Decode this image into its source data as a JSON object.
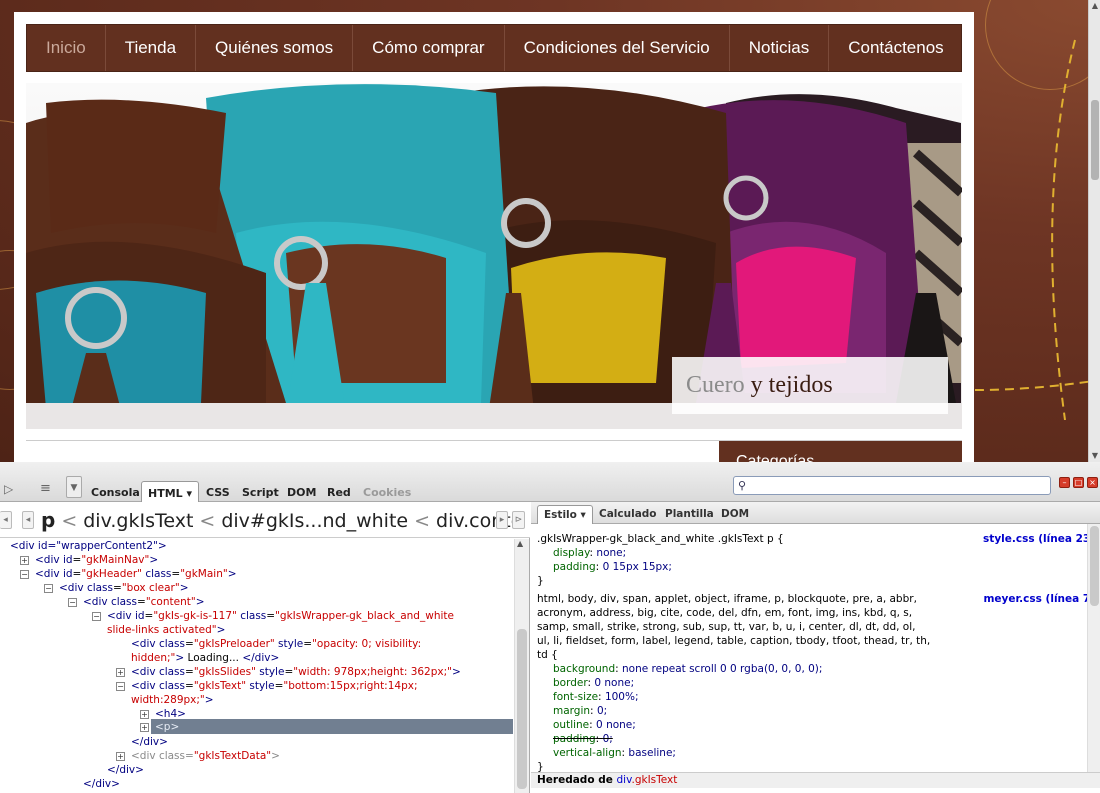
{
  "site": {
    "nav": [
      "Inicio",
      "Tienda",
      "Quiénes somos",
      "Cómo comprar",
      "Condiciones del Servicio",
      "Noticias",
      "Contáctenos"
    ],
    "caption_part1": "Cuero",
    "caption_part2": " y tejidos",
    "sidebar_heading": "Categorías"
  },
  "firebug": {
    "tabs": {
      "console": "Consola",
      "html": "HTML ▾",
      "css": "CSS",
      "script": "Script",
      "dom": "DOM",
      "net": "Red",
      "cookies": "Cookies"
    },
    "search_placeholder": "",
    "breadcrumb": {
      "first": "p",
      "items": [
        "div.gkIsText",
        "div#gkIs...nd_white",
        "div.conte"
      ]
    },
    "tree": [
      {
        "id": "r0",
        "text_tag": "<div id=\"wrapperContent2\">"
      },
      {
        "id": "r1",
        "tag": "<div ",
        "an": "id",
        "av": "\"gkMainNav\"",
        "end": ">"
      },
      {
        "id": "r2",
        "tag": "<div ",
        "an": "id",
        "av": "\"gkHeader\"",
        "an2": " class",
        "av2": "\"gkMain\"",
        "end": ">"
      },
      {
        "id": "r3",
        "tag": "<div ",
        "an": "class",
        "av": "\"box clear\"",
        "end": ">"
      },
      {
        "id": "r4",
        "tag": "<div ",
        "an": "class",
        "av": "\"content\"",
        "end": ">"
      },
      {
        "id": "r5",
        "tag": "<div ",
        "an": "id",
        "av": "\"gkIs-gk-is-117\"",
        "an2": " class",
        "av2": "\"gkIsWrapper-gk_black_and_white"
      },
      {
        "id": "r5b",
        "av": "slide-links activated\"",
        "end": ">"
      },
      {
        "id": "r6",
        "tag": "<div ",
        "an": "class",
        "av": "\"gkIsPreloader\"",
        "an2": " style",
        "av2": "\"opacity: 0; visibility:"
      },
      {
        "id": "r6b",
        "av": "hidden;\"",
        "end": ">",
        "text": "Loading...",
        "close": "</div>"
      },
      {
        "id": "r7",
        "tag": "<div ",
        "an": "class",
        "av": "\"gkIsSlides\"",
        "an2": " style",
        "av2": "\"width: 978px;height: 362px;\"",
        "end": ">"
      },
      {
        "id": "r8",
        "tag": "<div ",
        "an": "class",
        "av": "\"gkIsText\"",
        "an2": " style",
        "av2": "\"bottom:15px;right:14px;"
      },
      {
        "id": "r8b",
        "av": "width:289px;\"",
        "end": ">"
      },
      {
        "id": "r9",
        "tag": "<h4>"
      },
      {
        "id": "r10",
        "tag": "<p>"
      },
      {
        "id": "r11",
        "tag": "</div>"
      },
      {
        "id": "r12",
        "tag": "<div ",
        "an": "class",
        "av": "\"gkIsTextData\"",
        "end": ">"
      },
      {
        "id": "r13",
        "tag": "</div>"
      },
      {
        "id": "r14",
        "tag": "</div>"
      }
    ],
    "side_tabs": {
      "style": "Estilo ▾",
      "computed": "Calculado",
      "layout": "Plantilla",
      "dom": "DOM"
    },
    "rule1": {
      "selector": ".gkIsWrapper-gk_black_and_white .gkIsText p {",
      "source": "style.css (línea 23)",
      "props": [
        [
          "display",
          "none;"
        ],
        [
          "padding",
          "0 15px 15px;"
        ]
      ]
    },
    "rule2": {
      "selector_lines": [
        "html, body, div, span, applet, object, iframe, p, blockquote, pre, a, abbr,",
        "acronym, address, big, cite, code, del, dfn, em, font, img, ins, kbd, q, s,",
        "samp, small, strike, strong, sub, sup, tt, var, b, u, i, center, dl, dt, dd, ol,",
        "ul, li, fieldset, form, label, legend, table, caption, tbody, tfoot, thead, tr, th,",
        "td {"
      ],
      "source": "meyer.css (línea 7)",
      "props": [
        [
          "background",
          "none repeat scroll 0 0 rgba(0, 0, 0, 0);"
        ],
        [
          "border",
          "0 none;"
        ],
        [
          "font-size",
          "100%;"
        ],
        [
          "margin",
          "0;"
        ],
        [
          "outline",
          "0 none;"
        ],
        [
          "padding",
          "0;"
        ],
        [
          "vertical-align",
          "baseline;"
        ]
      ]
    },
    "inherited_label": "Heredado de ",
    "inherited_div": "div",
    "inherited_cls": ".gkIsText"
  }
}
